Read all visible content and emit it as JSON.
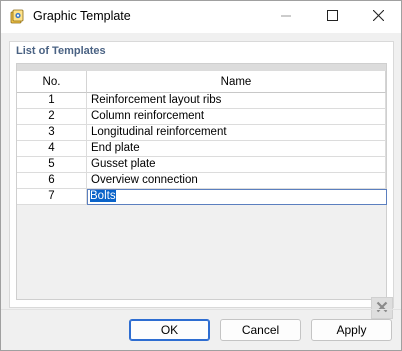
{
  "window": {
    "title": "Graphic Template",
    "icons": {
      "app": "template-icon",
      "minimize": "minimize-icon",
      "maximize": "maximize-icon",
      "close": "close-icon"
    }
  },
  "panel": {
    "label": "List of Templates",
    "columns": {
      "no": "No.",
      "name": "Name"
    },
    "rows": [
      {
        "no": "1",
        "name": "Reinforcement layout ribs"
      },
      {
        "no": "2",
        "name": "Column reinforcement"
      },
      {
        "no": "3",
        "name": "Longitudinal reinforcement"
      },
      {
        "no": "4",
        "name": "End plate"
      },
      {
        "no": "5",
        "name": "Gusset plate"
      },
      {
        "no": "6",
        "name": "Overview connection"
      }
    ],
    "editing_row": {
      "no": "7",
      "name": "Bolts"
    },
    "delete_icon": "delete-x-icon"
  },
  "buttons": {
    "ok": "OK",
    "cancel": "Cancel",
    "apply": "Apply"
  },
  "colors": {
    "accent": "#2e6dd1",
    "selection": "#0a63c9",
    "section_label": "#4a6283"
  }
}
